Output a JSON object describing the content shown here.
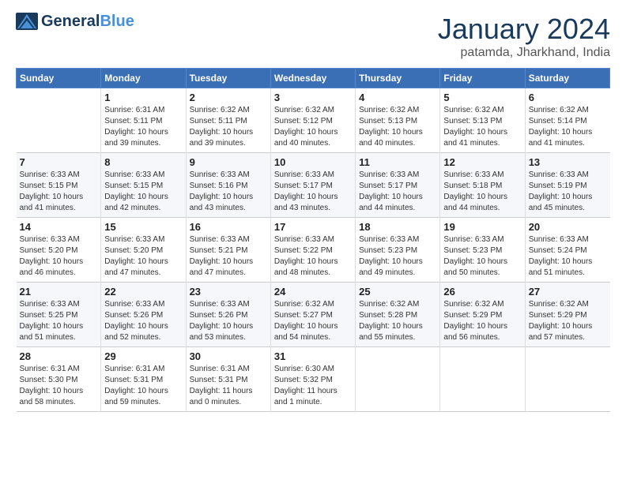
{
  "logo": {
    "general": "General",
    "blue": "Blue",
    "tagline": ""
  },
  "title": "January 2024",
  "location": "patamda, Jharkhand, India",
  "headers": [
    "Sunday",
    "Monday",
    "Tuesday",
    "Wednesday",
    "Thursday",
    "Friday",
    "Saturday"
  ],
  "weeks": [
    [
      {
        "num": "",
        "info": ""
      },
      {
        "num": "1",
        "info": "Sunrise: 6:31 AM\nSunset: 5:11 PM\nDaylight: 10 hours\nand 39 minutes."
      },
      {
        "num": "2",
        "info": "Sunrise: 6:32 AM\nSunset: 5:11 PM\nDaylight: 10 hours\nand 39 minutes."
      },
      {
        "num": "3",
        "info": "Sunrise: 6:32 AM\nSunset: 5:12 PM\nDaylight: 10 hours\nand 40 minutes."
      },
      {
        "num": "4",
        "info": "Sunrise: 6:32 AM\nSunset: 5:13 PM\nDaylight: 10 hours\nand 40 minutes."
      },
      {
        "num": "5",
        "info": "Sunrise: 6:32 AM\nSunset: 5:13 PM\nDaylight: 10 hours\nand 41 minutes."
      },
      {
        "num": "6",
        "info": "Sunrise: 6:32 AM\nSunset: 5:14 PM\nDaylight: 10 hours\nand 41 minutes."
      }
    ],
    [
      {
        "num": "7",
        "info": "Sunrise: 6:33 AM\nSunset: 5:15 PM\nDaylight: 10 hours\nand 41 minutes."
      },
      {
        "num": "8",
        "info": "Sunrise: 6:33 AM\nSunset: 5:15 PM\nDaylight: 10 hours\nand 42 minutes."
      },
      {
        "num": "9",
        "info": "Sunrise: 6:33 AM\nSunset: 5:16 PM\nDaylight: 10 hours\nand 43 minutes."
      },
      {
        "num": "10",
        "info": "Sunrise: 6:33 AM\nSunset: 5:17 PM\nDaylight: 10 hours\nand 43 minutes."
      },
      {
        "num": "11",
        "info": "Sunrise: 6:33 AM\nSunset: 5:17 PM\nDaylight: 10 hours\nand 44 minutes."
      },
      {
        "num": "12",
        "info": "Sunrise: 6:33 AM\nSunset: 5:18 PM\nDaylight: 10 hours\nand 44 minutes."
      },
      {
        "num": "13",
        "info": "Sunrise: 6:33 AM\nSunset: 5:19 PM\nDaylight: 10 hours\nand 45 minutes."
      }
    ],
    [
      {
        "num": "14",
        "info": "Sunrise: 6:33 AM\nSunset: 5:20 PM\nDaylight: 10 hours\nand 46 minutes."
      },
      {
        "num": "15",
        "info": "Sunrise: 6:33 AM\nSunset: 5:20 PM\nDaylight: 10 hours\nand 47 minutes."
      },
      {
        "num": "16",
        "info": "Sunrise: 6:33 AM\nSunset: 5:21 PM\nDaylight: 10 hours\nand 47 minutes."
      },
      {
        "num": "17",
        "info": "Sunrise: 6:33 AM\nSunset: 5:22 PM\nDaylight: 10 hours\nand 48 minutes."
      },
      {
        "num": "18",
        "info": "Sunrise: 6:33 AM\nSunset: 5:23 PM\nDaylight: 10 hours\nand 49 minutes."
      },
      {
        "num": "19",
        "info": "Sunrise: 6:33 AM\nSunset: 5:23 PM\nDaylight: 10 hours\nand 50 minutes."
      },
      {
        "num": "20",
        "info": "Sunrise: 6:33 AM\nSunset: 5:24 PM\nDaylight: 10 hours\nand 51 minutes."
      }
    ],
    [
      {
        "num": "21",
        "info": "Sunrise: 6:33 AM\nSunset: 5:25 PM\nDaylight: 10 hours\nand 51 minutes."
      },
      {
        "num": "22",
        "info": "Sunrise: 6:33 AM\nSunset: 5:26 PM\nDaylight: 10 hours\nand 52 minutes."
      },
      {
        "num": "23",
        "info": "Sunrise: 6:33 AM\nSunset: 5:26 PM\nDaylight: 10 hours\nand 53 minutes."
      },
      {
        "num": "24",
        "info": "Sunrise: 6:32 AM\nSunset: 5:27 PM\nDaylight: 10 hours\nand 54 minutes."
      },
      {
        "num": "25",
        "info": "Sunrise: 6:32 AM\nSunset: 5:28 PM\nDaylight: 10 hours\nand 55 minutes."
      },
      {
        "num": "26",
        "info": "Sunrise: 6:32 AM\nSunset: 5:29 PM\nDaylight: 10 hours\nand 56 minutes."
      },
      {
        "num": "27",
        "info": "Sunrise: 6:32 AM\nSunset: 5:29 PM\nDaylight: 10 hours\nand 57 minutes."
      }
    ],
    [
      {
        "num": "28",
        "info": "Sunrise: 6:31 AM\nSunset: 5:30 PM\nDaylight: 10 hours\nand 58 minutes."
      },
      {
        "num": "29",
        "info": "Sunrise: 6:31 AM\nSunset: 5:31 PM\nDaylight: 10 hours\nand 59 minutes."
      },
      {
        "num": "30",
        "info": "Sunrise: 6:31 AM\nSunset: 5:31 PM\nDaylight: 11 hours\nand 0 minutes."
      },
      {
        "num": "31",
        "info": "Sunrise: 6:30 AM\nSunset: 5:32 PM\nDaylight: 11 hours\nand 1 minute."
      },
      {
        "num": "",
        "info": ""
      },
      {
        "num": "",
        "info": ""
      },
      {
        "num": "",
        "info": ""
      }
    ]
  ]
}
